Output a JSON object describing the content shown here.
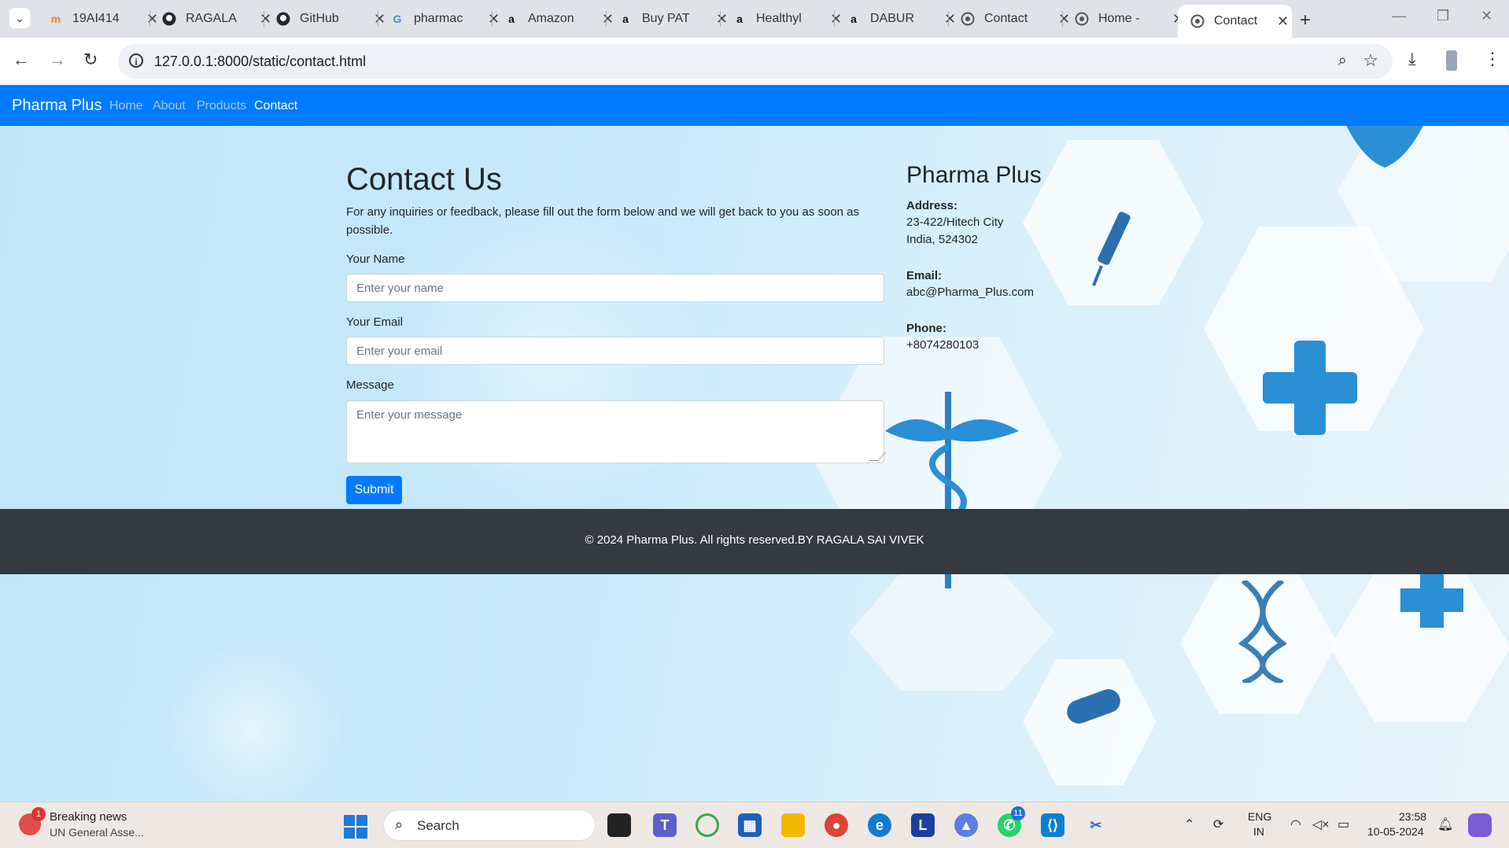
{
  "browser": {
    "tabs": [
      {
        "title": "19AI414",
        "favicon": "m-icon"
      },
      {
        "title": "RAGALA",
        "favicon": "github-icon"
      },
      {
        "title": "GitHub",
        "favicon": "github-icon"
      },
      {
        "title": "pharmac",
        "favicon": "google-icon"
      },
      {
        "title": "Amazon",
        "favicon": "amazon-icon"
      },
      {
        "title": "Buy PAT",
        "favicon": "amazon-icon"
      },
      {
        "title": "Healthyl",
        "favicon": "amazon-icon"
      },
      {
        "title": "DABUR",
        "favicon": "amazon-icon"
      },
      {
        "title": "Contact",
        "favicon": "globe-icon"
      },
      {
        "title": "Home -",
        "favicon": "globe-icon"
      },
      {
        "title": "Contact",
        "favicon": "globe-icon",
        "active": true
      }
    ],
    "url": "127.0.0.1:8000/static/contact.html"
  },
  "navbar": {
    "brand": "Pharma Plus",
    "links": [
      "Home",
      "About",
      "Products",
      "Contact"
    ],
    "active": "Contact"
  },
  "form": {
    "title": "Contact Us",
    "intro": "For any inquiries or feedback, please fill out the form below and we will get back to you as soon as possible.",
    "name_label": "Your Name",
    "name_placeholder": "Enter your name",
    "email_label": "Your Email",
    "email_placeholder": "Enter your email",
    "message_label": "Message",
    "message_placeholder": "Enter your message",
    "submit_label": "Submit"
  },
  "sidebar": {
    "title": "Pharma Plus",
    "address_label": "Address:",
    "address_line1": "23-422/Hitech City",
    "address_line2": "India, 524302",
    "email_label": "Email:",
    "email": "abc@Pharma_Plus.com",
    "phone_label": "Phone:",
    "phone": "+8074280103"
  },
  "footer": {
    "text": "© 2024 Pharma Plus. All rights reserved.BY RAGALA SAI VIVEK"
  },
  "taskbar": {
    "news_title": "Breaking news",
    "news_sub": "UN General Asse...",
    "news_badge": "1",
    "search": "Search",
    "whatsapp_badge": "11",
    "lang1": "ENG",
    "lang2": "IN",
    "time": "23:58",
    "date": "10-05-2024"
  },
  "colors": {
    "navbar": "#007bff",
    "footer": "#343a40",
    "submit": "#007bff"
  }
}
